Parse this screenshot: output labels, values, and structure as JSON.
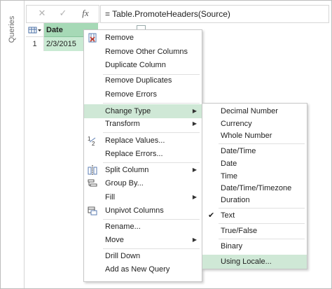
{
  "queries_pane": {
    "label": "Queries"
  },
  "formula_bar": {
    "cancel_glyph": "✕",
    "confirm_glyph": "✓",
    "fx_glyph": "fx",
    "formula": "= Table.PromoteHeaders(Source)"
  },
  "grid": {
    "column_header": "Date",
    "row_number": "1",
    "cell_value": "2/3/2015"
  },
  "context_menu": {
    "items": [
      {
        "label": "Remove",
        "icon": "remove-column-icon"
      },
      {
        "label": "Remove Other Columns"
      },
      {
        "label": "Duplicate Column"
      },
      {
        "label": "Remove Duplicates"
      },
      {
        "label": "Remove Errors"
      },
      {
        "label": "Change Type",
        "submenu": true,
        "highlighted": true
      },
      {
        "label": "Transform",
        "submenu": true
      },
      {
        "label": "Replace Values...",
        "icon": "replace-values-icon"
      },
      {
        "label": "Replace Errors..."
      },
      {
        "label": "Split Column",
        "submenu": true,
        "icon": "split-column-icon"
      },
      {
        "label": "Group By...",
        "icon": "group-by-icon"
      },
      {
        "label": "Fill",
        "submenu": true
      },
      {
        "label": "Unpivot Columns",
        "icon": "unpivot-icon"
      },
      {
        "label": "Rename..."
      },
      {
        "label": "Move",
        "submenu": true
      },
      {
        "label": "Drill Down"
      },
      {
        "label": "Add as New Query"
      }
    ]
  },
  "type_submenu": {
    "items": [
      {
        "label": "Decimal Number"
      },
      {
        "label": "Currency"
      },
      {
        "label": "Whole Number"
      },
      {
        "label": "Date/Time"
      },
      {
        "label": "Date"
      },
      {
        "label": "Time"
      },
      {
        "label": "Date/Time/Timezone"
      },
      {
        "label": "Duration"
      },
      {
        "label": "Text",
        "checked": true
      },
      {
        "label": "True/False"
      },
      {
        "label": "Binary"
      },
      {
        "label": "Using Locale...",
        "highlighted": true
      }
    ]
  },
  "colors": {
    "selection_green": "#cfe8d6",
    "header_green": "#a6d9b6"
  }
}
